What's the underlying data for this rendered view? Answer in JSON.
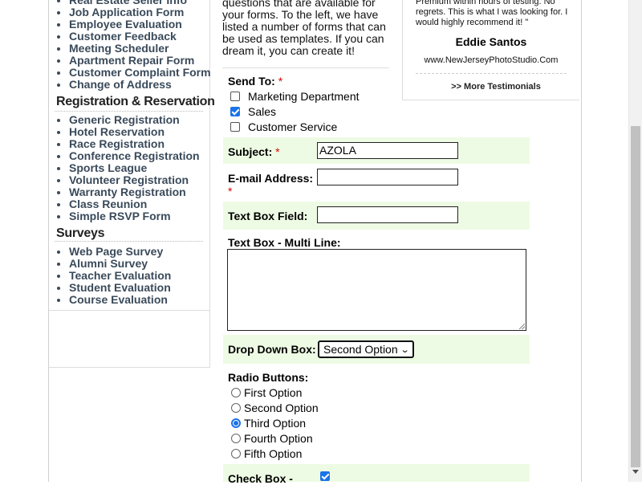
{
  "sidebar": {
    "top_list": [
      "Real Estate Seller Info",
      "Job Application Form",
      "Employee Evaluation",
      "Customer Feedback",
      "Meeting Scheduler",
      "Apartment Repair Form",
      "Customer Complaint Form",
      "Change of Address"
    ],
    "registration_heading": "Registration & Reservation",
    "registration_list": [
      "Generic Registration",
      "Hotel Reservation",
      "Race Registration",
      "Conference Registration",
      "Sports League",
      "Volunteer Registration",
      "Warranty Registration",
      "Class Reunion",
      "Simple RSVP Form"
    ],
    "surveys_heading": "Surveys",
    "surveys_list": [
      "Web Page Survey",
      "Alumni Survey",
      "Teacher Evaluation",
      "Student Evaluation",
      "Course Evaluation"
    ]
  },
  "intro": {
    "text": "questions that are available for your forms. To the left, we have listed a number of forms that can be used as templates. If you can dream it, you can create it!"
  },
  "testimonial": {
    "quote": "Premium within hours of testing. No regrets. This is what I was looking for. I would highly recommend it! \"",
    "name": "Eddie Santos",
    "site": "www.NewJerseyPhotoStudio.Com",
    "more_link": ">> More Testimonials"
  },
  "form": {
    "required_mark": "*",
    "send_to": {
      "label": "Send To:",
      "options": [
        {
          "label": "Marketing Department",
          "checked": false
        },
        {
          "label": "Sales",
          "checked": true
        },
        {
          "label": "Customer Service",
          "checked": false
        }
      ]
    },
    "subject": {
      "label": "Subject:",
      "value": "AZOLA"
    },
    "email": {
      "label": "E-mail Address:",
      "value": ""
    },
    "text_box": {
      "label": "Text Box Field:",
      "value": ""
    },
    "multi_line": {
      "label": "Text Box - Multi Line:",
      "value": ""
    },
    "drop_down": {
      "label": "Drop Down Box:",
      "selected": "Second Option"
    },
    "radio": {
      "label": "Radio Buttons:",
      "options": [
        "First Option",
        "Second Option",
        "Third Option",
        "Fourth Option",
        "Fifth Option"
      ],
      "selected_index": 2
    },
    "check_box": {
      "label": "Check Box -",
      "checked": true
    }
  },
  "colors": {
    "row_shade": "#eefbe4",
    "required": "#dd0000",
    "accent": "#1a73e8"
  }
}
